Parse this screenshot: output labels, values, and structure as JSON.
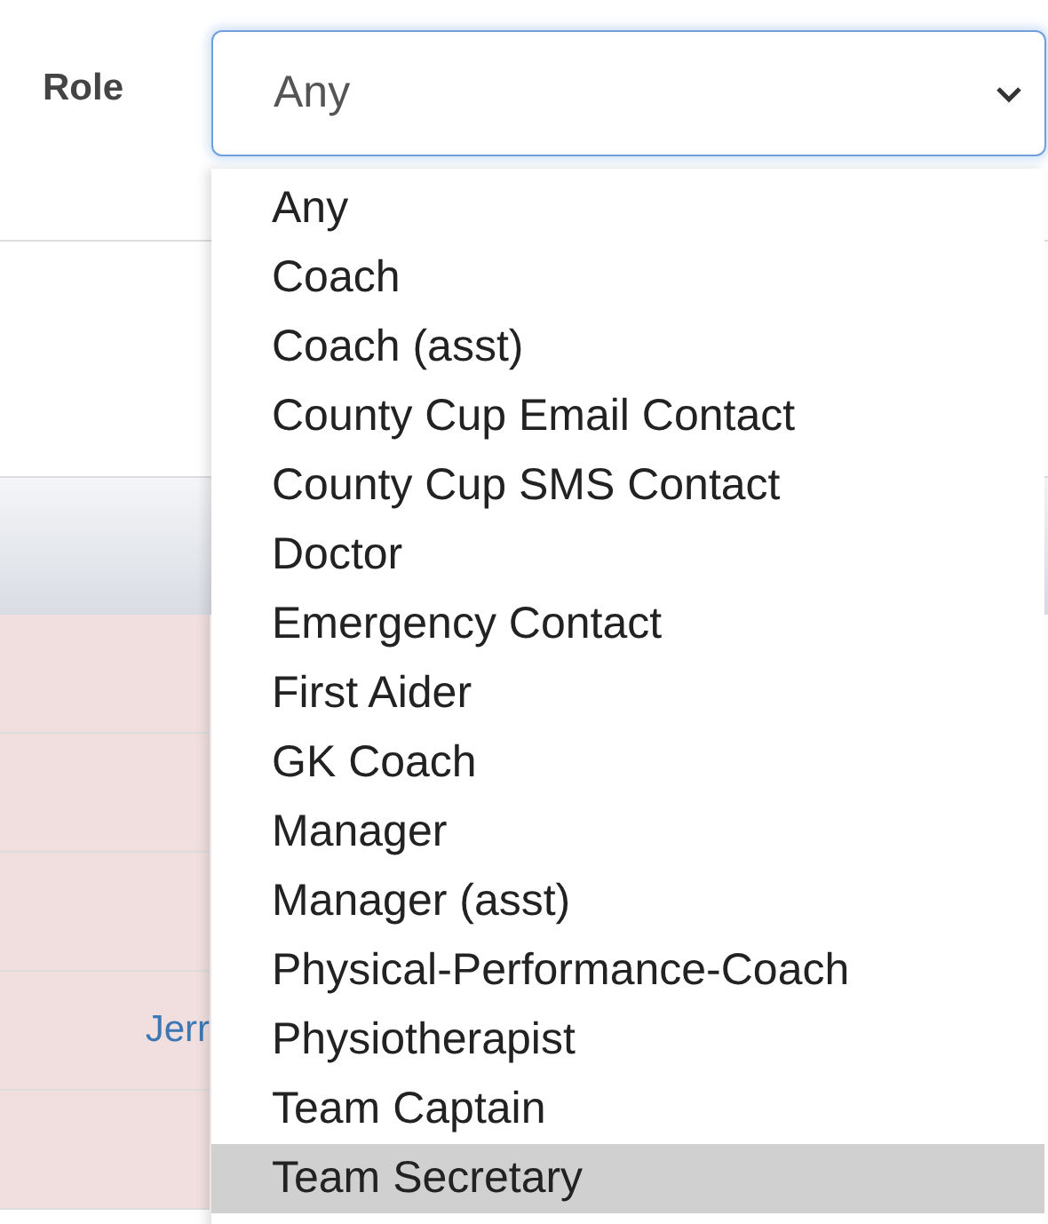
{
  "filter": {
    "label": "Role",
    "value": "Any",
    "options": [
      {
        "label": "Any",
        "highlighted": false
      },
      {
        "label": "Coach",
        "highlighted": false
      },
      {
        "label": "Coach (asst)",
        "highlighted": false
      },
      {
        "label": "County Cup Email Contact",
        "highlighted": false
      },
      {
        "label": "County Cup SMS Contact",
        "highlighted": false
      },
      {
        "label": "Doctor",
        "highlighted": false
      },
      {
        "label": "Emergency Contact",
        "highlighted": false
      },
      {
        "label": "First Aider",
        "highlighted": false
      },
      {
        "label": "GK Coach",
        "highlighted": false
      },
      {
        "label": "Manager",
        "highlighted": false
      },
      {
        "label": "Manager (asst)",
        "highlighted": false
      },
      {
        "label": "Physical-Performance-Coach",
        "highlighted": false
      },
      {
        "label": "Physiotherapist",
        "highlighted": false
      },
      {
        "label": "Team Captain",
        "highlighted": false
      },
      {
        "label": "Team Secretary",
        "highlighted": true
      }
    ]
  },
  "table": {
    "rows": [
      {
        "name": null
      },
      {
        "name": null
      },
      {
        "name": null
      },
      {
        "name": "Jerr"
      },
      {
        "name": null
      }
    ]
  }
}
